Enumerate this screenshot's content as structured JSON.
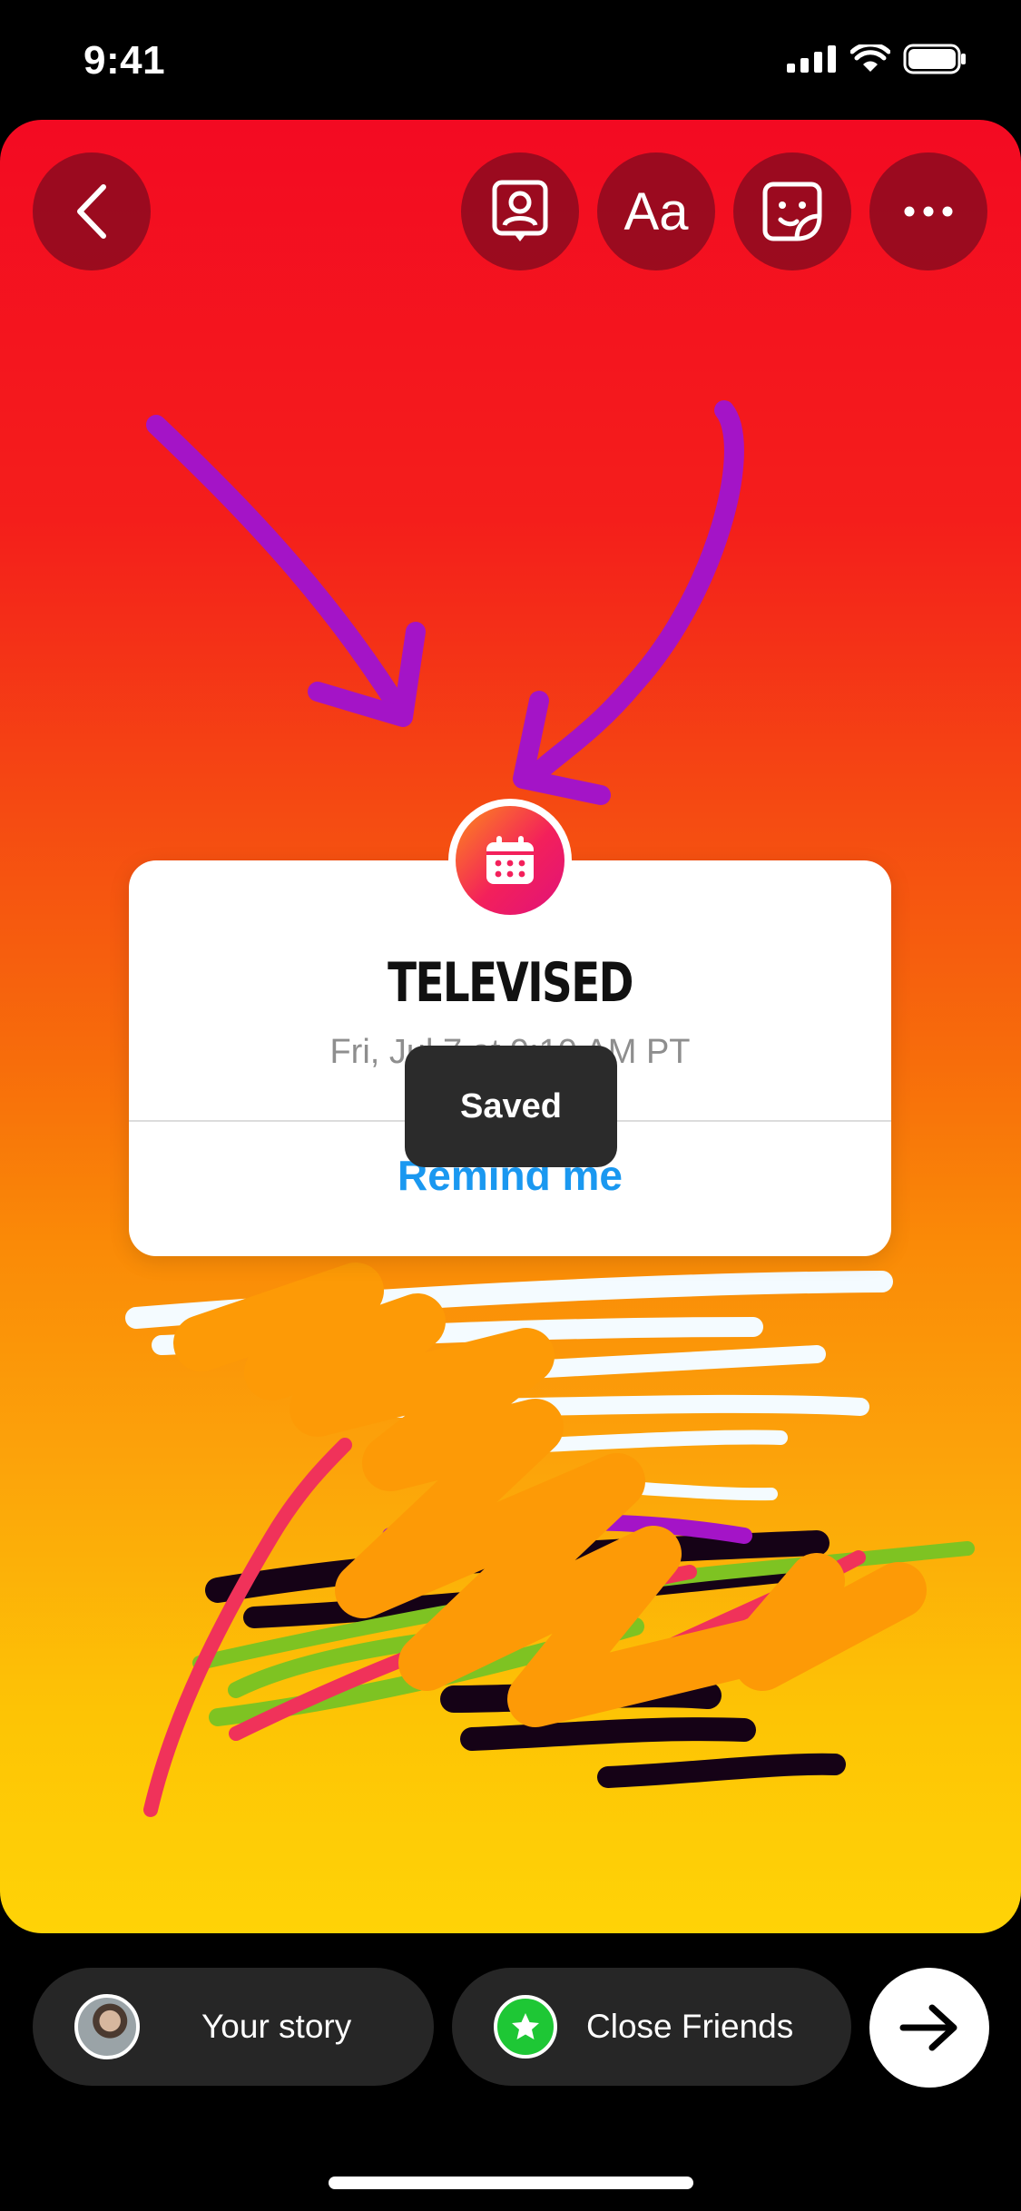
{
  "status_bar": {
    "time": "9:41"
  },
  "toolbar": {
    "back_icon": "chevron-left-icon",
    "mention_icon": "mention-sticker-icon",
    "text_label": "Aa",
    "sticker_icon": "sticker-icon",
    "more_icon": "more-horizontal-icon"
  },
  "event_sticker": {
    "icon": "calendar-icon",
    "title": "TELEVISED",
    "date": "Fri, Jul 7 at 9:10 AM PT",
    "action": "Remind me"
  },
  "toast": {
    "text": "Saved"
  },
  "share_bar": {
    "your_story": "Your story",
    "close_friends": "Close Friends",
    "next_icon": "arrow-right-icon"
  },
  "colors": {
    "gradient_top": "#f30a22",
    "gradient_bottom": "#ffd306",
    "remind_blue": "#1a98f0",
    "close_friends_green": "#1ec735",
    "arrow_purple": "#a414c7"
  }
}
